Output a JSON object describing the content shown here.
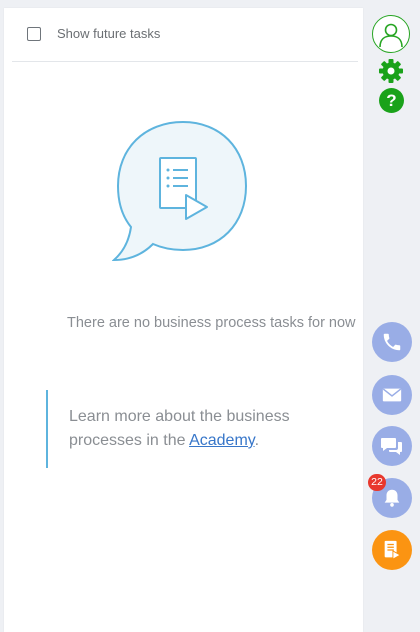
{
  "toolbar": {
    "show_future_label": "Show future tasks"
  },
  "empty_state": {
    "message": "There are no business process tasks for now",
    "info_prefix": "Learn more about the business processes in the ",
    "info_link": "Academy",
    "info_suffix": "."
  },
  "rail": {
    "notifications_count": "22",
    "help_glyph": "?"
  },
  "colors": {
    "accent_blue": "#5eb4de",
    "rail_blue": "#99ade6",
    "profile_green": "#27a523",
    "bp_orange": "#fb9412",
    "badge_red": "#e8382d"
  },
  "icons": [
    "checkbox-icon",
    "process-bubble-icon",
    "user-icon",
    "gear-icon",
    "help-icon",
    "phone-icon",
    "mail-icon",
    "chat-icon",
    "bell-icon",
    "business-process-icon"
  ]
}
